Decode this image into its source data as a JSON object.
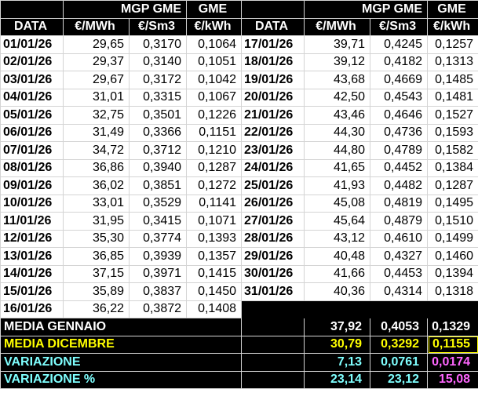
{
  "header": {
    "row1": {
      "mgp_left": "MGP GME",
      "gme_left": "GME",
      "mgp_right": "MGP GME",
      "gme_right": "GME"
    },
    "row2": {
      "data": "DATA",
      "mwh": "€/MWh",
      "sm3": "€/Sm3",
      "kwh": "€/kWh"
    }
  },
  "left_rows": [
    {
      "date": "01/01/26",
      "mwh": "29,65",
      "sm3": "0,3170",
      "kwh": "0,1064"
    },
    {
      "date": "02/01/26",
      "mwh": "29,37",
      "sm3": "0,3140",
      "kwh": "0,1051"
    },
    {
      "date": "03/01/26",
      "mwh": "29,67",
      "sm3": "0,3172",
      "kwh": "0,1042"
    },
    {
      "date": "04/01/26",
      "mwh": "31,01",
      "sm3": "0,3315",
      "kwh": "0,1067"
    },
    {
      "date": "05/01/26",
      "mwh": "32,75",
      "sm3": "0,3501",
      "kwh": "0,1226"
    },
    {
      "date": "06/01/26",
      "mwh": "31,49",
      "sm3": "0,3366",
      "kwh": "0,1151"
    },
    {
      "date": "07/01/26",
      "mwh": "34,72",
      "sm3": "0,3712",
      "kwh": "0,1210"
    },
    {
      "date": "08/01/26",
      "mwh": "36,86",
      "sm3": "0,3940",
      "kwh": "0,1287"
    },
    {
      "date": "09/01/26",
      "mwh": "36,02",
      "sm3": "0,3851",
      "kwh": "0,1272"
    },
    {
      "date": "10/01/26",
      "mwh": "33,01",
      "sm3": "0,3529",
      "kwh": "0,1141"
    },
    {
      "date": "11/01/26",
      "mwh": "31,95",
      "sm3": "0,3415",
      "kwh": "0,1071"
    },
    {
      "date": "12/01/26",
      "mwh": "35,30",
      "sm3": "0,3774",
      "kwh": "0,1393"
    },
    {
      "date": "13/01/26",
      "mwh": "36,85",
      "sm3": "0,3939",
      "kwh": "0,1357"
    },
    {
      "date": "14/01/26",
      "mwh": "37,15",
      "sm3": "0,3971",
      "kwh": "0,1415"
    },
    {
      "date": "15/01/26",
      "mwh": "35,89",
      "sm3": "0,3837",
      "kwh": "0,1450"
    },
    {
      "date": "16/01/26",
      "mwh": "36,22",
      "sm3": "0,3872",
      "kwh": "0,1408"
    }
  ],
  "right_rows": [
    {
      "date": "17/01/26",
      "mwh": "39,71",
      "sm3": "0,4245",
      "kwh": "0,1257"
    },
    {
      "date": "18/01/26",
      "mwh": "39,12",
      "sm3": "0,4182",
      "kwh": "0,1313"
    },
    {
      "date": "19/01/26",
      "mwh": "43,68",
      "sm3": "0,4669",
      "kwh": "0,1485"
    },
    {
      "date": "20/01/26",
      "mwh": "42,50",
      "sm3": "0,4543",
      "kwh": "0,1481"
    },
    {
      "date": "21/01/26",
      "mwh": "43,46",
      "sm3": "0,4646",
      "kwh": "0,1527"
    },
    {
      "date": "22/01/26",
      "mwh": "44,30",
      "sm3": "0,4736",
      "kwh": "0,1593"
    },
    {
      "date": "23/01/26",
      "mwh": "44,80",
      "sm3": "0,4789",
      "kwh": "0,1582"
    },
    {
      "date": "24/01/26",
      "mwh": "41,65",
      "sm3": "0,4452",
      "kwh": "0,1384"
    },
    {
      "date": "25/01/26",
      "mwh": "41,93",
      "sm3": "0,4482",
      "kwh": "0,1287"
    },
    {
      "date": "26/01/26",
      "mwh": "45,08",
      "sm3": "0,4819",
      "kwh": "0,1495"
    },
    {
      "date": "27/01/26",
      "mwh": "45,64",
      "sm3": "0,4879",
      "kwh": "0,1510"
    },
    {
      "date": "28/01/26",
      "mwh": "43,12",
      "sm3": "0,4610",
      "kwh": "0,1499"
    },
    {
      "date": "29/01/26",
      "mwh": "40,48",
      "sm3": "0,4327",
      "kwh": "0,1460"
    },
    {
      "date": "30/01/26",
      "mwh": "41,66",
      "sm3": "0,4453",
      "kwh": "0,1394"
    },
    {
      "date": "31/01/26",
      "mwh": "40,36",
      "sm3": "0,4314",
      "kwh": "0,1318"
    }
  ],
  "summary": [
    {
      "label": "MEDIA GENNAIO",
      "mwh": "37,92",
      "sm3": "0,4053",
      "kwh": "0,1329",
      "color": "#ffffff",
      "kwh_color": "#ffffff"
    },
    {
      "label": "MEDIA DICEMBRE",
      "mwh": "30,79",
      "sm3": "0,3292",
      "kwh": "0,1155",
      "color": "#ffff00",
      "kwh_color": "#ffff00"
    },
    {
      "label": "VARIAZIONE",
      "mwh": "7,13",
      "sm3": "0,0761",
      "kwh": "0,0174",
      "color": "#7fffff",
      "kwh_color": "#ff66ff"
    },
    {
      "label": "VARIAZIONE %",
      "mwh": "23,14",
      "sm3": "23,12",
      "kwh": "15,08",
      "color": "#7fffff",
      "kwh_color": "#ff66ff"
    }
  ]
}
